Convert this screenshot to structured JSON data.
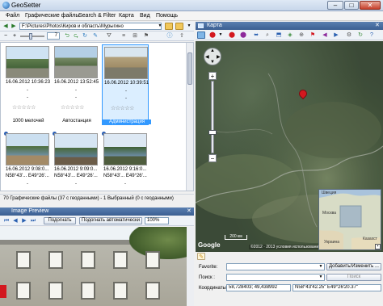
{
  "window": {
    "title": "GeoSetter",
    "min_glyph": "–",
    "max_glyph": "□",
    "close_glyph": "✕"
  },
  "menu": [
    "Файл",
    "Графические файлы",
    "Search & Filter",
    "Карта",
    "Вид",
    "Помощь"
  ],
  "toolbar": {
    "path": "F:\\Pictures\\Photos\\Киров и область\\Мурыгино",
    "zoom_value": "7"
  },
  "thumbnails": [
    {
      "date": "16.06.2012 10:36:23",
      "caption": "1000 мелочей",
      "selected": false,
      "geotagged": false
    },
    {
      "date": "16.06.2012 13:52:45",
      "caption": "Автостанция",
      "selected": false,
      "geotagged": false
    },
    {
      "date": "16.06.2012 10:39:51",
      "caption": "Администрация",
      "selected": true,
      "geotagged": false
    },
    {
      "date": "16.06.2012 9:08:0...",
      "coord": "N58°43'... E49°26'...",
      "caption": "",
      "selected": false,
      "geotagged": true
    },
    {
      "date": "16.06.2012 9:09:0...",
      "coord": "N58°43'... E49°26'...",
      "caption": "",
      "selected": false,
      "geotagged": true
    },
    {
      "date": "16.06.2012 9:16:0...",
      "coord": "N58°43'... E49°26'...",
      "caption": "",
      "selected": false,
      "geotagged": true
    }
  ],
  "dash": "-",
  "stars": "☆☆☆☆☆",
  "statusbar": {
    "text": "70 Графические файлы (37 с геоданными) - 1 Выбранный (0 с геоданными)"
  },
  "preview": {
    "title": "Image Preview",
    "fit_label": "Подогнать",
    "fit_auto_label": "Подогнать автоматически",
    "zoom": "100%"
  },
  "map": {
    "title": "Карта",
    "scale_km": "200 км",
    "copyright": "©2012 · 2013 условия использования",
    "google": "Google",
    "minimap_labels": [
      "Швеция",
      "Москва",
      "Украина",
      "Казахст"
    ]
  },
  "form": {
    "favorite_label": "Favorite:",
    "add_favorite_button": "Добавить/Изменить ...",
    "search_label": "Поиск :",
    "search_button": "Поиск",
    "coords_label": "Координаты :",
    "coords_decimal": "58,728403; 49,438992",
    "coords_dms": "N58°43'42.25\" E49°26'20.37\""
  },
  "colors": {
    "accent": "#3b5f92",
    "selection": "#3399ff",
    "marker": "#d3181f"
  }
}
